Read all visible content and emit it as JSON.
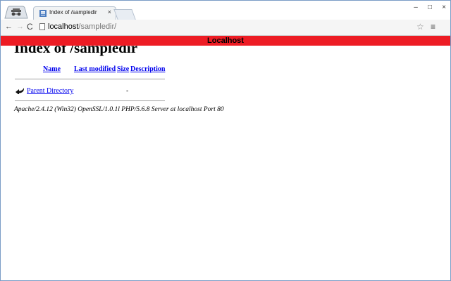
{
  "window": {
    "tab_title": "Index of /sampledir",
    "tab_close": "×",
    "controls": {
      "minimize": "–",
      "maximize": "□",
      "close": "×"
    }
  },
  "toolbar": {
    "back": "←",
    "forward": "→",
    "reload": "C",
    "url_host": "localhost",
    "url_path": "/sampledir/",
    "star": "☆",
    "menu": "≡"
  },
  "page": {
    "banner_text": "Localhost",
    "banner_color": "#ed1c24",
    "heading": "Index of /sampledir",
    "columns": {
      "name": "Name",
      "last_modified": "Last modified",
      "size": "Size",
      "description": "Description"
    },
    "rows": [
      {
        "icon": "back-arrow-icon",
        "name": "Parent Directory",
        "last_modified": "",
        "size": "-",
        "description": ""
      }
    ],
    "server_signature": "Apache/2.4.12 (Win32) OpenSSL/1.0.1l PHP/5.6.8 Server at localhost Port 80"
  }
}
